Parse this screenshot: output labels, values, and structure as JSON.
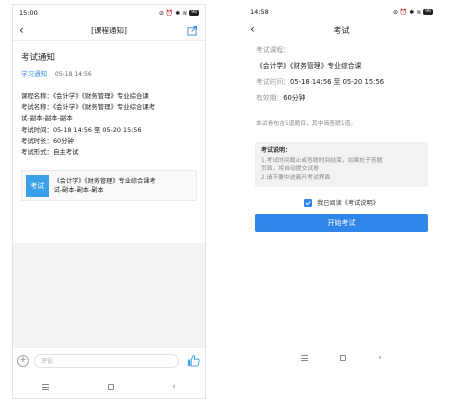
{
  "left": {
    "status": {
      "time": "15:00",
      "icons_text": "⊘ ⏰ ✱ ≋",
      "battery": "96"
    },
    "nav": {
      "title": "[课程通知]"
    },
    "post": {
      "title": "考试通知",
      "category": "学习通知",
      "time": "05-18 14:56",
      "lines": [
        "课程名称：《会计学》《财务管理》专业综合课",
        "考试名称：《会计学》《财务管理》专业综合课考",
        "试-副本-副本-副本",
        "考试时间：05-18 14:56 至 05-20 15:56",
        "考试时长：60分钟",
        "考试形式：自主考试"
      ]
    },
    "card": {
      "badge": "考试",
      "line1": "《会计学》《财务管理》专业综合课考",
      "line2": "试-副本-副本-副本"
    },
    "comment": {
      "placeholder": "评论"
    }
  },
  "right": {
    "status": {
      "time": "14:58",
      "icons_text": "⊘ ⏰ ✱ ≋",
      "battery": "96"
    },
    "nav": {
      "title": "考试"
    },
    "exam": {
      "course_label": "考试课程：",
      "course_name": "《会计学》《财务管理》专业综合课",
      "time_label": "考试时间：",
      "time_value": "05-18 14:56 至 05-20 15:56",
      "valid_label": "有效期：",
      "valid_value": "60分钟",
      "hint": "本试卷包含1道题目，其中简答题1道。"
    },
    "instructions": {
      "title": "考试说明：",
      "line1": "1.考试时间截止或答题时间结束，如果处于答题",
      "line2": "页面，将自动提交试卷",
      "line3": "2.请不要中途离开考试界面"
    },
    "agree_text": "我已阅读《考试说明》",
    "start_button": "开始考试"
  },
  "icons": {
    "back": "back-arrow-icon",
    "share": "share-icon",
    "plus": "plus-circle-icon",
    "thumb": "thumbs-up-icon",
    "check": "checkmark-icon"
  },
  "colors": {
    "accent": "#2f86e8",
    "badge": "#3aa0e8",
    "link": "#3a8ee6"
  }
}
